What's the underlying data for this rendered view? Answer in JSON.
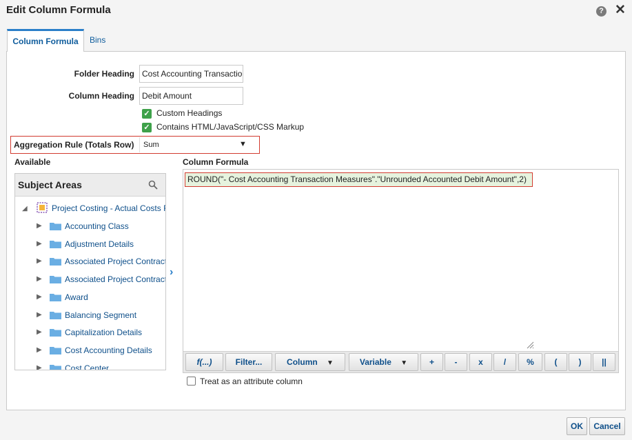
{
  "dialog": {
    "title": "Edit Column Formula",
    "help_glyph": "?",
    "close_glyph": "✕"
  },
  "tabs": [
    {
      "label": "Column Formula",
      "active": true
    },
    {
      "label": "Bins",
      "active": false
    }
  ],
  "fields": {
    "folder_heading_label": "Folder Heading",
    "folder_heading_value": "Cost Accounting Transactio",
    "column_heading_label": "Column Heading",
    "column_heading_value": "Debit Amount",
    "custom_headings_label": "Custom Headings",
    "custom_headings_checked": true,
    "html_markup_label": "Contains HTML/JavaScript/CSS Markup",
    "html_markup_checked": true,
    "aggregation_label": "Aggregation Rule (Totals Row)",
    "aggregation_value": "Sum"
  },
  "available": {
    "label": "Available",
    "subject_areas_title": "Subject Areas",
    "root": "Project Costing - Actual Costs R",
    "items": [
      "Accounting Class",
      "Adjustment Details",
      "Associated Project Contract",
      "Associated Project Contract",
      "Award",
      "Balancing Segment",
      "Capitalization Details",
      "Cost Accounting Details",
      "Cost Center"
    ]
  },
  "formula": {
    "label": "Column Formula",
    "text": "ROUND(\"- Cost Accounting Transaction Measures\".\"Unrounded Accounted Debit Amount\",2)"
  },
  "toolbar": {
    "function_label": "f(...)",
    "filter_label": "Filter...",
    "column_label": "Column",
    "variable_label": "Variable",
    "plus": "+",
    "minus": "-",
    "multiply": "x",
    "divide": "/",
    "percent": "%",
    "open_paren": "(",
    "close_paren": ")",
    "concat": "||"
  },
  "attribute_column": {
    "label": "Treat as an attribute column",
    "checked": false
  },
  "footer": {
    "ok_label": "OK",
    "cancel_label": "Cancel"
  },
  "colors": {
    "accent": "#2a7fc9",
    "link": "#0e4f8a",
    "highlight_border": "#d23a2e",
    "check_green": "#3ea14a",
    "formula_bg": "#e6f3de"
  }
}
